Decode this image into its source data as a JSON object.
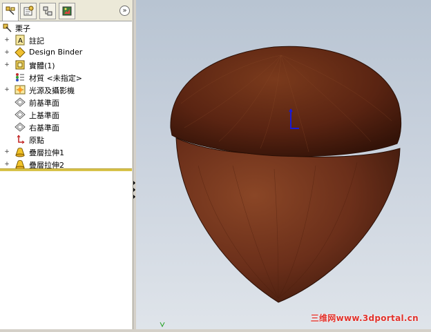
{
  "tabs": [
    {
      "name": "featuremanager-tab",
      "icon": "feature-tree-icon"
    },
    {
      "name": "propertymanager-tab",
      "icon": "property-icon"
    },
    {
      "name": "configurationmanager-tab",
      "icon": "configuration-icon"
    },
    {
      "name": "displaymanager-tab",
      "icon": "display-icon"
    }
  ],
  "expand_symbol": "»",
  "tree": {
    "root": {
      "label": "栗子",
      "icon": "part-icon"
    },
    "items": [
      {
        "label": "註記",
        "icon": "annotations-icon",
        "expander": "+"
      },
      {
        "label": "Design Binder",
        "icon": "design-binder-icon",
        "expander": "+"
      },
      {
        "label": "實體(1)",
        "icon": "solid-bodies-icon",
        "expander": "+"
      },
      {
        "label": "材質 <未指定>",
        "icon": "material-icon",
        "expander": ""
      },
      {
        "label": "光源及攝影機",
        "icon": "lights-cameras-icon",
        "expander": "+"
      },
      {
        "label": "前基準面",
        "icon": "plane-icon",
        "expander": ""
      },
      {
        "label": "上基準面",
        "icon": "plane-icon",
        "expander": ""
      },
      {
        "label": "右基準面",
        "icon": "plane-icon",
        "expander": ""
      },
      {
        "label": "原點",
        "icon": "origin-icon",
        "expander": ""
      },
      {
        "label": "疊層拉伸1",
        "icon": "loft-icon",
        "expander": "+"
      },
      {
        "label": "疊層拉伸2",
        "icon": "loft-icon",
        "expander": "+"
      }
    ]
  },
  "watermark": "三维网www.3dportal.cn",
  "colors": {
    "shell": "#6b2f1a",
    "cap": "#5a2412",
    "accent": "#d8c34a"
  }
}
